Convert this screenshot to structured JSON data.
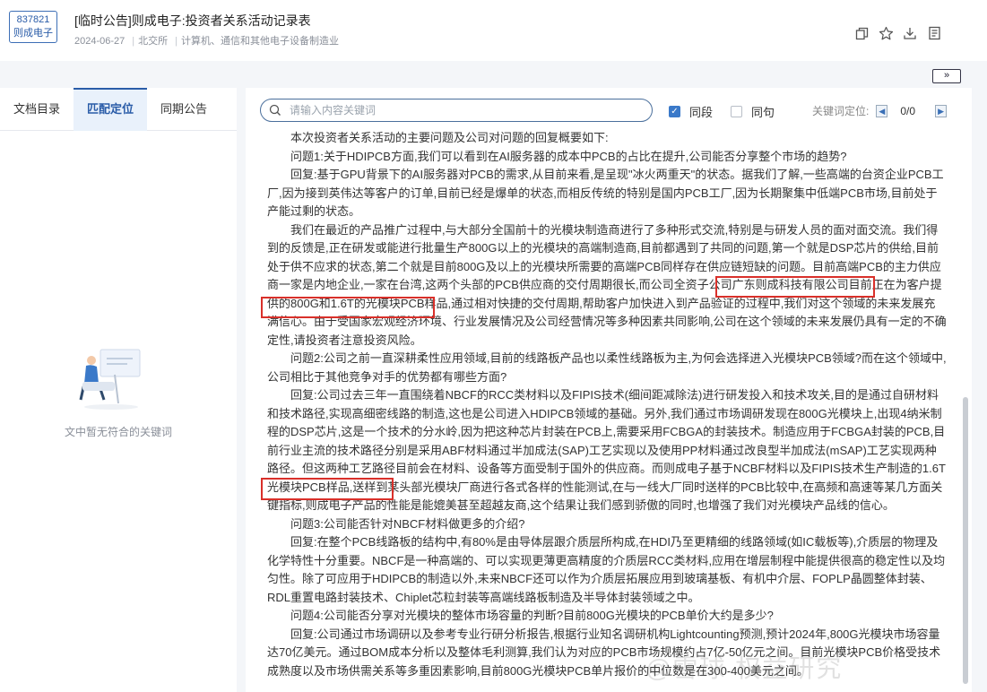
{
  "header": {
    "stock_code": "837821",
    "stock_name": "则成电子",
    "title": "[临时公告]则成电子:投资者关系活动记录表",
    "date": "2024-06-27",
    "exchange": "北交所",
    "industry": "计算机、通信和其他电子设备制造业"
  },
  "header_icons": [
    "copy-icon",
    "star-icon",
    "download-icon",
    "document-icon"
  ],
  "collapse_label": "»",
  "tabs": [
    {
      "label": "文档目录"
    },
    {
      "label": "匹配定位"
    },
    {
      "label": "同期公告"
    }
  ],
  "left_empty_text": "文中暂无符合的关键词",
  "search": {
    "placeholder": "请输入内容关键词",
    "value": ""
  },
  "filters": {
    "paragraph_label": "同段",
    "paragraph_checked": true,
    "sentence_label": "同句",
    "sentence_checked": false
  },
  "keyword_nav": {
    "label": "关键词定位:",
    "count": "0/0"
  },
  "paragraphs": [
    "本次投资者关系活动的主要问题及公司对问题的回复概要如下:",
    "问题1:关于HDIPCB方面,我们可以看到在AI服务器的成本中PCB的占比在提升,公司能否分享整个市场的趋势?",
    "回复:基于GPU背景下的AI服务器对PCB的需求,从目前来看,是呈现\"冰火两重天\"的状态。据我们了解,一些高端的台资企业PCB工厂,因为接到英伟达等客户的订单,目前已经是爆单的状态,而相反传统的特别是国内PCB工厂,因为长期聚集中低端PCB市场,目前处于产能过剩的状态。",
    "我们在最近的产品推广过程中,与大部分全国前十的光模块制造商进行了多种形式交流,特别是与研发人员的面对面交流。我们得到的反馈是,正在研发或能进行批量生产800G以上的光模块的高端制造商,目前都遇到了共同的问题,第一个就是DSP芯片的供给,目前处于供不应求的状态,第二个就是目前800G及以上的光模块所需要的高端PCB同样存在供应链短缺的问题。目前高端PCB的主力供应商一家是内地企业,一家在台湾,这两个头部的PCB供应商的交付周期很长,而公司全资子公司广东则成科技有限公司目前正在为客户提供的800G和1.6T的光模块PCB样品,通过相对快捷的交付周期,帮助客户加快进入到产品验证的过程中,我们对这个领域的未来发展充满信心。由于受国家宏观经济环境、行业发展情况及公司经营情况等多种因素共同影响,公司在这个领域的未来发展仍具有一定的不确定性,请投资者注意投资风险。",
    "问题2:公司之前一直深耕柔性应用领域,目前的线路板产品也以柔性线路板为主,为何会选择进入光模块PCB领域?而在这个领域中,公司相比于其他竞争对手的优势都有哪些方面?",
    "回复:公司过去三年一直围绕着NBCF的RCC类材料以及FIPIS技术(细间距减除法)进行研发投入和技术攻关,目的是通过自研材料和技术路径,实现高细密线路的制造,这也是公司进入HDIPCB领域的基础。另外,我们通过市场调研发现在800G光模块上,出现4纳米制程的DSP芯片,这是一个技术的分水岭,因为把这种芯片封装在PCB上,需要采用FCBGA的封装技术。制造应用于FCBGA封装的PCB,目前行业主流的技术路径分别是采用ABF材料通过半加成法(SAP)工艺实现以及使用PP材料通过改良型半加成法(mSAP)工艺实现两种路径。但这两种工艺路径目前会在材料、设备等方面受制于国外的供应商。而则成电子基于NCBF材料以及FIPIS技术生产制造的1.6T光模块PCB样品,送样到某头部光模块厂商进行各式各样的性能测试,在与一线大厂同时送样的PCB比较中,在高频和高速等某几方面关键指标,则成电子产品的性能是能媲美甚至超越友商,这个结果让我们感到骄傲的同时,也增强了我们对光模块产品线的信心。",
    "问题3:公司能否针对NBCF材料做更多的介绍?",
    "回复:在整个PCB线路板的结构中,有80%是由导体层跟介质层所构成,在HDI乃至更精细的线路领域(如IC载板等),介质层的物理及化学特性十分重要。NBCF是一种高端的、可以实现更薄更高精度的介质层RCC类材料,应用在增层制程中能提供很高的稳定性以及均匀性。除了可应用于HDIPCB的制造以外,未来NBCF还可以作为介质层拓展应用到玻璃基板、有机中介层、FOPLP晶圆整体封装、RDL重置电路封装技术、Chiplet芯粒封装等高端线路板制造及半导体封装领域之中。",
    "问题4:公司能否分享对光模块的整体市场容量的判断?目前800G光模块的PCB单价大约是多少?",
    "回复:公司通过市场调研以及参考专业行研分析报告,根据行业知名调研机构Lightcounting预测,预计2024年,800G光模块市场容量达70亿美元。通过BOM成本分析以及整体毛利测算,我们认为对应的PCB市场规模约占7亿-50亿元之间。目前光模块PCB价格受技术成熟度以及市场供需关系等多重因素影响,目前800G光模块PCB单片报价的中位数是在300-400美元之间。"
  ],
  "watermark": "@雪球 权益研究"
}
